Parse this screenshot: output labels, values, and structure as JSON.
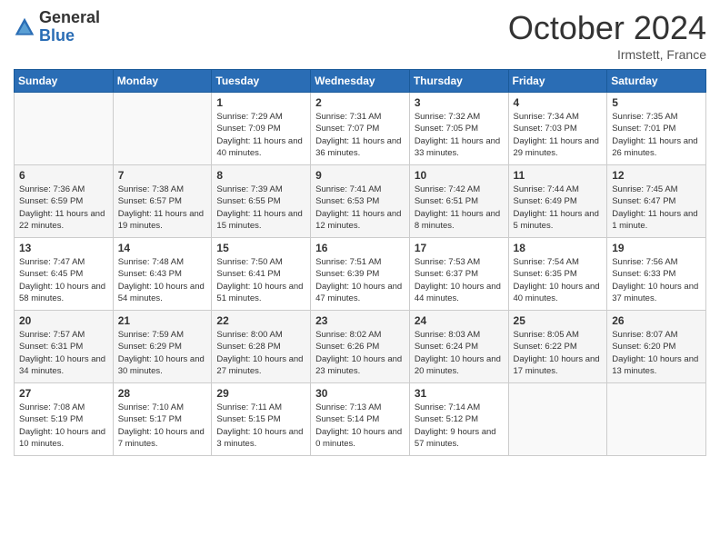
{
  "logo": {
    "general": "General",
    "blue": "Blue"
  },
  "title": "October 2024",
  "subtitle": "Irmstett, France",
  "days_of_week": [
    "Sunday",
    "Monday",
    "Tuesday",
    "Wednesday",
    "Thursday",
    "Friday",
    "Saturday"
  ],
  "weeks": [
    [
      {
        "day": "",
        "empty": true
      },
      {
        "day": "",
        "empty": true
      },
      {
        "day": "1",
        "sunrise": "Sunrise: 7:29 AM",
        "sunset": "Sunset: 7:09 PM",
        "daylight": "Daylight: 11 hours and 40 minutes."
      },
      {
        "day": "2",
        "sunrise": "Sunrise: 7:31 AM",
        "sunset": "Sunset: 7:07 PM",
        "daylight": "Daylight: 11 hours and 36 minutes."
      },
      {
        "day": "3",
        "sunrise": "Sunrise: 7:32 AM",
        "sunset": "Sunset: 7:05 PM",
        "daylight": "Daylight: 11 hours and 33 minutes."
      },
      {
        "day": "4",
        "sunrise": "Sunrise: 7:34 AM",
        "sunset": "Sunset: 7:03 PM",
        "daylight": "Daylight: 11 hours and 29 minutes."
      },
      {
        "day": "5",
        "sunrise": "Sunrise: 7:35 AM",
        "sunset": "Sunset: 7:01 PM",
        "daylight": "Daylight: 11 hours and 26 minutes."
      }
    ],
    [
      {
        "day": "6",
        "sunrise": "Sunrise: 7:36 AM",
        "sunset": "Sunset: 6:59 PM",
        "daylight": "Daylight: 11 hours and 22 minutes."
      },
      {
        "day": "7",
        "sunrise": "Sunrise: 7:38 AM",
        "sunset": "Sunset: 6:57 PM",
        "daylight": "Daylight: 11 hours and 19 minutes."
      },
      {
        "day": "8",
        "sunrise": "Sunrise: 7:39 AM",
        "sunset": "Sunset: 6:55 PM",
        "daylight": "Daylight: 11 hours and 15 minutes."
      },
      {
        "day": "9",
        "sunrise": "Sunrise: 7:41 AM",
        "sunset": "Sunset: 6:53 PM",
        "daylight": "Daylight: 11 hours and 12 minutes."
      },
      {
        "day": "10",
        "sunrise": "Sunrise: 7:42 AM",
        "sunset": "Sunset: 6:51 PM",
        "daylight": "Daylight: 11 hours and 8 minutes."
      },
      {
        "day": "11",
        "sunrise": "Sunrise: 7:44 AM",
        "sunset": "Sunset: 6:49 PM",
        "daylight": "Daylight: 11 hours and 5 minutes."
      },
      {
        "day": "12",
        "sunrise": "Sunrise: 7:45 AM",
        "sunset": "Sunset: 6:47 PM",
        "daylight": "Daylight: 11 hours and 1 minute."
      }
    ],
    [
      {
        "day": "13",
        "sunrise": "Sunrise: 7:47 AM",
        "sunset": "Sunset: 6:45 PM",
        "daylight": "Daylight: 10 hours and 58 minutes."
      },
      {
        "day": "14",
        "sunrise": "Sunrise: 7:48 AM",
        "sunset": "Sunset: 6:43 PM",
        "daylight": "Daylight: 10 hours and 54 minutes."
      },
      {
        "day": "15",
        "sunrise": "Sunrise: 7:50 AM",
        "sunset": "Sunset: 6:41 PM",
        "daylight": "Daylight: 10 hours and 51 minutes."
      },
      {
        "day": "16",
        "sunrise": "Sunrise: 7:51 AM",
        "sunset": "Sunset: 6:39 PM",
        "daylight": "Daylight: 10 hours and 47 minutes."
      },
      {
        "day": "17",
        "sunrise": "Sunrise: 7:53 AM",
        "sunset": "Sunset: 6:37 PM",
        "daylight": "Daylight: 10 hours and 44 minutes."
      },
      {
        "day": "18",
        "sunrise": "Sunrise: 7:54 AM",
        "sunset": "Sunset: 6:35 PM",
        "daylight": "Daylight: 10 hours and 40 minutes."
      },
      {
        "day": "19",
        "sunrise": "Sunrise: 7:56 AM",
        "sunset": "Sunset: 6:33 PM",
        "daylight": "Daylight: 10 hours and 37 minutes."
      }
    ],
    [
      {
        "day": "20",
        "sunrise": "Sunrise: 7:57 AM",
        "sunset": "Sunset: 6:31 PM",
        "daylight": "Daylight: 10 hours and 34 minutes."
      },
      {
        "day": "21",
        "sunrise": "Sunrise: 7:59 AM",
        "sunset": "Sunset: 6:29 PM",
        "daylight": "Daylight: 10 hours and 30 minutes."
      },
      {
        "day": "22",
        "sunrise": "Sunrise: 8:00 AM",
        "sunset": "Sunset: 6:28 PM",
        "daylight": "Daylight: 10 hours and 27 minutes."
      },
      {
        "day": "23",
        "sunrise": "Sunrise: 8:02 AM",
        "sunset": "Sunset: 6:26 PM",
        "daylight": "Daylight: 10 hours and 23 minutes."
      },
      {
        "day": "24",
        "sunrise": "Sunrise: 8:03 AM",
        "sunset": "Sunset: 6:24 PM",
        "daylight": "Daylight: 10 hours and 20 minutes."
      },
      {
        "day": "25",
        "sunrise": "Sunrise: 8:05 AM",
        "sunset": "Sunset: 6:22 PM",
        "daylight": "Daylight: 10 hours and 17 minutes."
      },
      {
        "day": "26",
        "sunrise": "Sunrise: 8:07 AM",
        "sunset": "Sunset: 6:20 PM",
        "daylight": "Daylight: 10 hours and 13 minutes."
      }
    ],
    [
      {
        "day": "27",
        "sunrise": "Sunrise: 7:08 AM",
        "sunset": "Sunset: 5:19 PM",
        "daylight": "Daylight: 10 hours and 10 minutes."
      },
      {
        "day": "28",
        "sunrise": "Sunrise: 7:10 AM",
        "sunset": "Sunset: 5:17 PM",
        "daylight": "Daylight: 10 hours and 7 minutes."
      },
      {
        "day": "29",
        "sunrise": "Sunrise: 7:11 AM",
        "sunset": "Sunset: 5:15 PM",
        "daylight": "Daylight: 10 hours and 3 minutes."
      },
      {
        "day": "30",
        "sunrise": "Sunrise: 7:13 AM",
        "sunset": "Sunset: 5:14 PM",
        "daylight": "Daylight: 10 hours and 0 minutes."
      },
      {
        "day": "31",
        "sunrise": "Sunrise: 7:14 AM",
        "sunset": "Sunset: 5:12 PM",
        "daylight": "Daylight: 9 hours and 57 minutes."
      },
      {
        "day": "",
        "empty": true
      },
      {
        "day": "",
        "empty": true
      }
    ]
  ]
}
